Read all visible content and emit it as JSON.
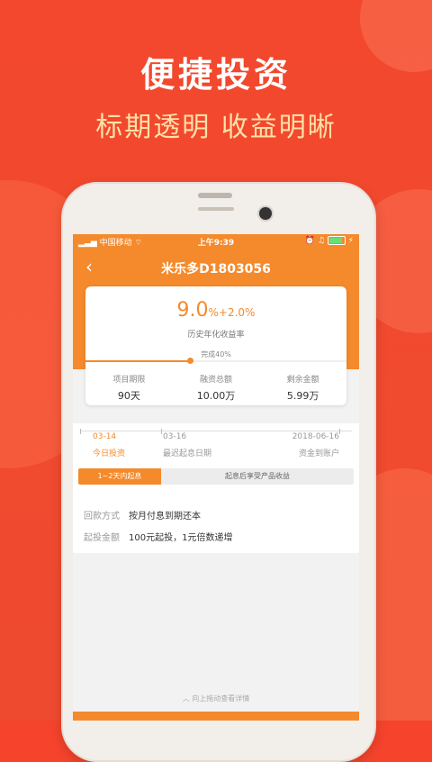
{
  "marketing": {
    "headline": "便捷投资",
    "subline": "标期透明 收益明晰"
  },
  "status_bar": {
    "carrier": "中国移动",
    "time": "上午9:39"
  },
  "nav": {
    "title": "米乐多D1803056"
  },
  "summary": {
    "rate_main": "9.0",
    "rate_suffix": "%+2.0%",
    "rate_label": "历史年化收益率",
    "progress_label": "完成40%",
    "progress_fraction": 0.4,
    "stats": [
      {
        "label": "项目期限",
        "value": "90天"
      },
      {
        "label": "融资总额",
        "value": "10.00万"
      },
      {
        "label": "剩余金额",
        "value": "5.99万"
      }
    ]
  },
  "timeline": {
    "points": [
      {
        "date": "03-14",
        "text": "今日投资"
      },
      {
        "date": "03-16",
        "text": "最迟起息日期"
      },
      {
        "date": "2018-06-16",
        "text": "资金到账户"
      }
    ],
    "phase1": "1~2天内起息",
    "phase2": "起息后享受产品收益"
  },
  "details": {
    "repayment_label": "回款方式",
    "repayment_value": "按月付息到期还本",
    "min_label": "起投金额",
    "min_value": "100元起投，1元倍数递增"
  },
  "footer": {
    "hint": "︿ 向上拖动查看详情"
  },
  "colors": {
    "accent": "#f48a2c",
    "background": "#f5432c"
  }
}
